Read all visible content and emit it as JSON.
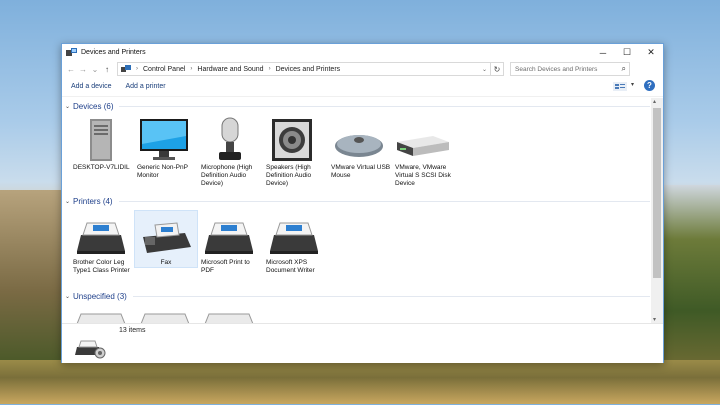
{
  "window": {
    "title": "Devices and Printers",
    "controls": {
      "minimize": "─",
      "maximize": "☐",
      "close": "✕"
    }
  },
  "address": {
    "back": "←",
    "forward": "→",
    "recent": "⌄",
    "up": "↑",
    "crumbs": [
      "Control Panel",
      "Hardware and Sound",
      "Devices and Printers"
    ],
    "search_placeholder": "Search Devices and Printers"
  },
  "toolbar": {
    "add_device": "Add a device",
    "add_printer": "Add a printer",
    "help": "?"
  },
  "groups": {
    "devices": {
      "header": "Devices (6)",
      "items": [
        {
          "label": "DESKTOP-V7LIDIL",
          "icon": "computer-tower-icon"
        },
        {
          "label": "Generic Non-PnP Monitor",
          "icon": "monitor-icon"
        },
        {
          "label": "Microphone (High Definition Audio Device)",
          "icon": "microphone-icon"
        },
        {
          "label": "Speakers (High Definition Audio Device)",
          "icon": "speaker-icon"
        },
        {
          "label": "VMware Virtual USB Mouse",
          "icon": "mouse-icon"
        },
        {
          "label": "VMware, VMware Virtual S SCSI Disk Device",
          "icon": "disk-drive-icon"
        }
      ]
    },
    "printers": {
      "header": "Printers (4)",
      "items": [
        {
          "label": "Brother Color Leg Type1 Class Printer",
          "icon": "printer-icon"
        },
        {
          "label": "Fax",
          "icon": "fax-icon"
        },
        {
          "label": "Microsoft Print to PDF",
          "icon": "printer-icon"
        },
        {
          "label": "Microsoft XPS Document Writer",
          "icon": "printer-icon"
        }
      ]
    },
    "unspecified": {
      "header": "Unspecified (3)"
    }
  },
  "status": {
    "count": "13 items"
  }
}
